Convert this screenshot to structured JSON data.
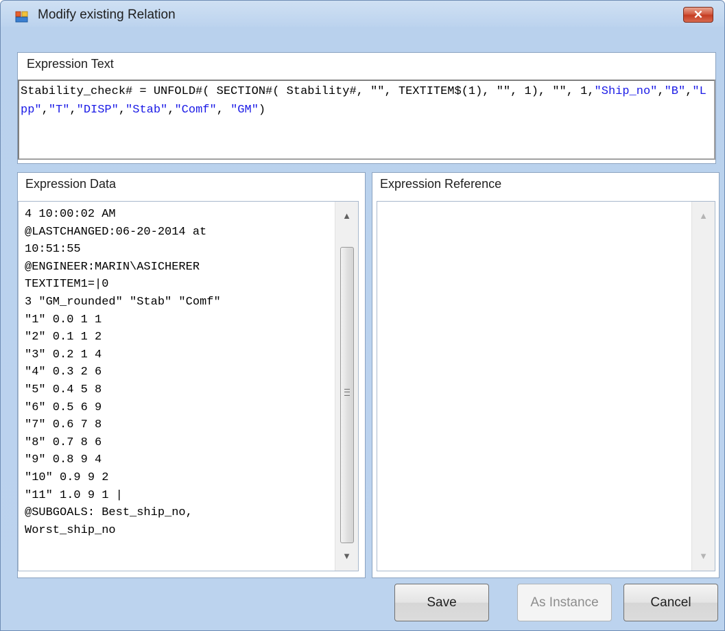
{
  "window": {
    "title": "Modify existing Relation",
    "close_label": "✕",
    "icon": "form-icon"
  },
  "expression_text": {
    "label": "Expression Text",
    "value_parts": [
      {
        "text": "Stability_check# = UNFOLD#( SECTION#( Stability#, \"\", TEXTITEM$(1), \"\", 1), \"\", 1,",
        "kind": "code"
      },
      {
        "text": "\"Ship_no\"",
        "kind": "str"
      },
      {
        "text": ",",
        "kind": "code"
      },
      {
        "text": "\"B\"",
        "kind": "str"
      },
      {
        "text": ",",
        "kind": "code"
      },
      {
        "text": "\"Lpp\"",
        "kind": "str"
      },
      {
        "text": ",",
        "kind": "code"
      },
      {
        "text": "\"T\"",
        "kind": "str"
      },
      {
        "text": ",",
        "kind": "code"
      },
      {
        "text": "\"DISP\"",
        "kind": "str"
      },
      {
        "text": ",",
        "kind": "code"
      },
      {
        "text": "\"Stab\"",
        "kind": "str"
      },
      {
        "text": ",",
        "kind": "code"
      },
      {
        "text": "\"Comf\"",
        "kind": "str"
      },
      {
        "text": ", ",
        "kind": "code"
      },
      {
        "text": "\"GM\"",
        "kind": "str"
      },
      {
        "text": ")",
        "kind": "code"
      }
    ]
  },
  "expression_data": {
    "label": "Expression Data",
    "lines": [
      "4 10:00:02 AM",
      "@LASTCHANGED:06-20-2014 at",
      "10:51:55",
      "@ENGINEER:MARIN\\ASICHERER",
      "TEXTITEM1=|0",
      "3 \"GM_rounded\" \"Stab\" \"Comf\"",
      "\"1\" 0.0 1 1",
      "\"2\" 0.1 1 2",
      "\"3\" 0.2 1 4",
      "\"4\" 0.3 2 6",
      "\"5\" 0.4 5 8",
      "\"6\" 0.5 6 9",
      "\"7\" 0.6 7 8",
      "\"8\" 0.7 8 6",
      "\"9\" 0.8 9 4",
      "\"10\" 0.9 9 2",
      "\"11\" 1.0 9 1 |",
      "@SUBGOALS: Best_ship_no,",
      "Worst_ship_no"
    ],
    "scroll_up": "▲",
    "scroll_down": "▼"
  },
  "expression_reference": {
    "label": "Expression Reference",
    "scroll_up": "▲",
    "scroll_down": "▼"
  },
  "buttons": {
    "save": "Save",
    "as_instance": "As Instance",
    "cancel": "Cancel"
  }
}
